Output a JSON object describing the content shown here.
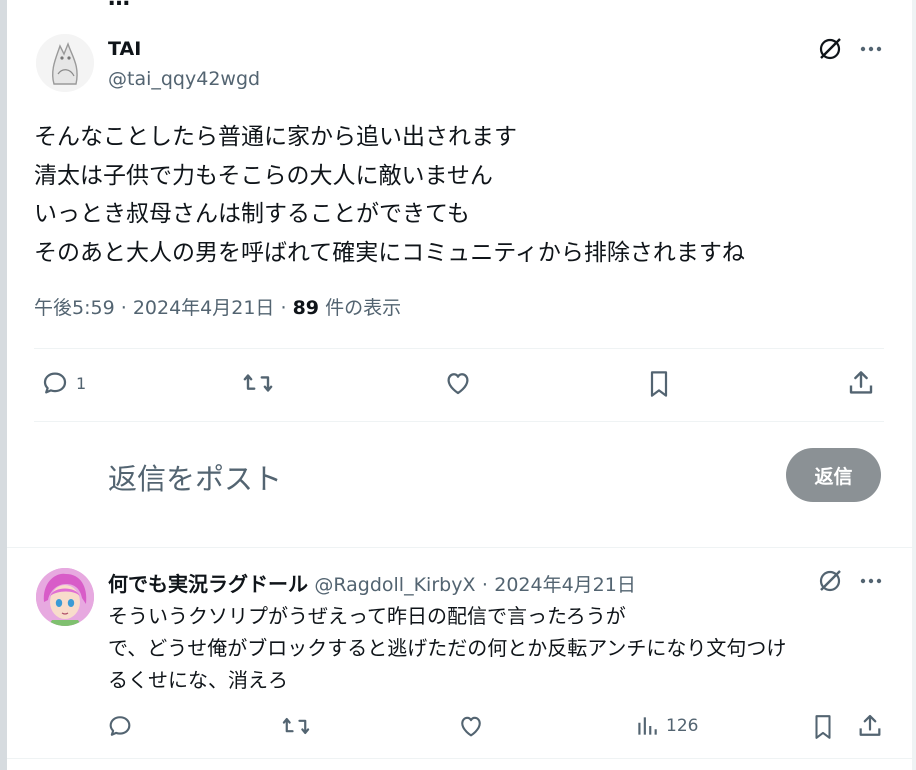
{
  "top_cut_title": "…",
  "tweet": {
    "author_name": "TAI",
    "author_handle": "@tai_qqy42wgd",
    "body_lines": [
      "そんなことしたら普通に家から追い出されます",
      "清太は子供で力もそこらの大人に敵いません",
      "いっとき叔母さんは制することができても",
      "そのあと大人の男を呼ばれて確実にコミュニティから排除されますね"
    ],
    "time": "午後5:59",
    "sep1": "·",
    "date": "2024年4月21日",
    "sep2": "·",
    "views_count": "89",
    "views_label": "件の表示",
    "reply_count": "1",
    "icons": {
      "grok": "grok-icon",
      "more": "more-icon",
      "reply": "reply-icon",
      "retweet": "retweet-icon",
      "like": "like-icon",
      "bookmark": "bookmark-icon",
      "share": "share-icon"
    }
  },
  "composer": {
    "placeholder": "返信をポスト",
    "button_label": "返信"
  },
  "reply": {
    "author_name": "何でも実況ラグドール",
    "author_handle": "@Ragdoll_KirbyX",
    "sep": "·",
    "date": "2024年4月21日",
    "body_lines": [
      "そういうクソリプがうぜえって昨日の配信で言ったろうが",
      "で、どうせ俺がブロックすると逃げただの何とか反転アンチになり文句つけ",
      "るくせにな、消えろ"
    ],
    "views_count": "126"
  },
  "colors": {
    "text": "#0f1419",
    "muted": "#536471",
    "divider": "#eff3f4",
    "button_disabled": "#8b9195"
  }
}
